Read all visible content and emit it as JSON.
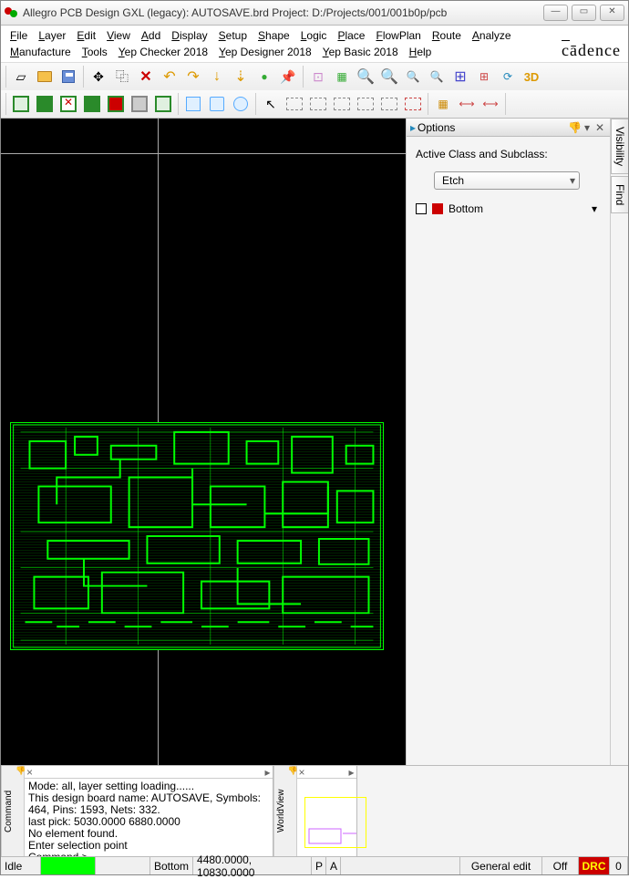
{
  "title": "Allegro PCB Design GXL (legacy): AUTOSAVE.brd  Project: D:/Projects/001/001b0p/pcb",
  "menu": {
    "row1": [
      "File",
      "Layer",
      "Edit",
      "View",
      "Add",
      "Display",
      "Setup",
      "Shape",
      "Logic",
      "Place",
      "FlowPlan",
      "Route",
      "Analyze"
    ],
    "row2": [
      "Manufacture",
      "Tools",
      "Yep Checker 2018",
      "Yep Designer 2018",
      "Yep Basic 2018",
      "Help"
    ]
  },
  "brand": "ādence",
  "options": {
    "title": "Options",
    "active_label": "Active Class and Subclass:",
    "class_value": "Etch",
    "subclass_value": "Bottom"
  },
  "vtabs": [
    "Visibility",
    "Find"
  ],
  "command": {
    "label": "Command",
    "lines": [
      "Mode: all, layer setting loading......",
      "This design board name: AUTOSAVE, Symbols: 464, Pins: 1593, Nets: 332.",
      "last pick:  5030.0000 6880.0000",
      "No element found.",
      "Enter selection point",
      "Command >"
    ]
  },
  "worldview": {
    "label": "WorldView"
  },
  "status": {
    "idle": "Idle",
    "layer": "Bottom",
    "coords": "4480.0000, 10830.0000",
    "p": "P",
    "a": "A",
    "mode": "General edit",
    "off": "Off",
    "drc": "DRC",
    "count": "0"
  }
}
